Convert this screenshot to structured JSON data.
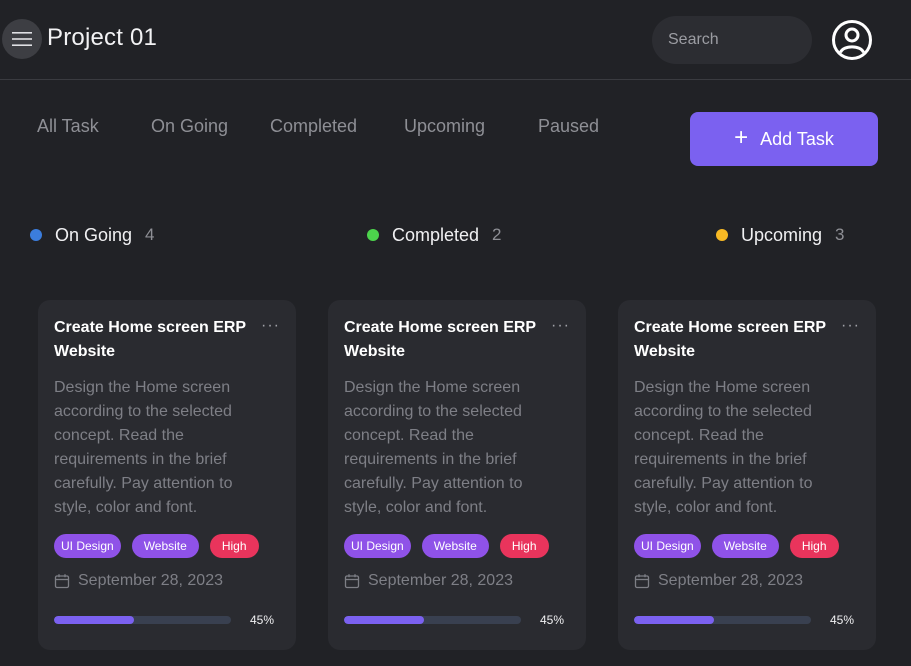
{
  "header": {
    "title": "Project 01",
    "search_placeholder": "Search"
  },
  "tabs": [
    {
      "label": "All Task"
    },
    {
      "label": "On Going"
    },
    {
      "label": "Completed"
    },
    {
      "label": "Upcoming"
    },
    {
      "label": "Paused"
    }
  ],
  "add_task": {
    "label": "Add Task"
  },
  "columns": [
    {
      "name": "On Going",
      "count": "4",
      "color": "#3b7ddd"
    },
    {
      "name": "Completed",
      "count": "2",
      "color": "#4cd34c"
    },
    {
      "name": "Upcoming",
      "count": "3",
      "color": "#f7b924"
    }
  ],
  "cards": [
    {
      "title": "Create Home screen ERP Website",
      "description": "Design the Home screen according to the selected concept. Read the requirements in the brief carefully. Pay attention to style, color and font.",
      "tags": [
        "UI Design",
        "Website",
        "High"
      ],
      "date": "September 28, 2023",
      "progress": 45,
      "progress_label": "45%"
    },
    {
      "title": "Create Home screen ERP Website",
      "description": "Design the Home screen according to the selected concept. Read the requirements in the brief carefully. Pay attention to style, color and font.",
      "tags": [
        "UI Design",
        "Website",
        "High"
      ],
      "date": "September 28, 2023",
      "progress": 45,
      "progress_label": "45%"
    },
    {
      "title": "Create Home screen ERP Website",
      "description": "Design the Home screen according to the selected concept. Read the requirements in the brief carefully. Pay attention to style, color and font.",
      "tags": [
        "UI Design",
        "Website",
        "High"
      ],
      "date": "September 28, 2023",
      "progress": 45,
      "progress_label": "45%"
    }
  ],
  "icons": {
    "menu": "hamburger-icon",
    "avatar": "user-circle-icon",
    "add": "plus-icon",
    "more": "more-horizontal-icon",
    "date": "calendar-icon"
  },
  "colors": {
    "accent": "#7b61f0",
    "tag_purple": "#8f52e8",
    "tag_high": "#e9345c",
    "background": "#212226",
    "card": "#2a2b30"
  }
}
